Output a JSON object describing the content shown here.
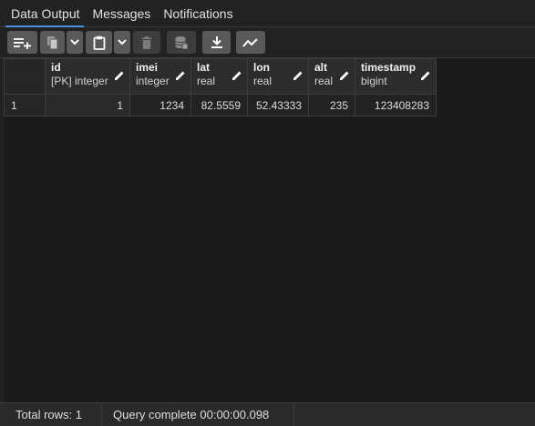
{
  "tabs": [
    {
      "label": "Data Output",
      "active": true
    },
    {
      "label": "Messages",
      "active": false
    },
    {
      "label": "Notifications",
      "active": false
    }
  ],
  "toolbar": {
    "buttons": [
      {
        "name": "add-row-button",
        "icon": "add-row-icon",
        "enabled": true
      },
      {
        "name": "copy-button",
        "icon": "copy-icon",
        "enabled": false
      },
      {
        "name": "copy-dropdown-button",
        "icon": "chevron-down-icon",
        "enabled": true
      },
      {
        "name": "paste-button",
        "icon": "clipboard-icon",
        "enabled": true
      },
      {
        "name": "paste-dropdown-button",
        "icon": "chevron-down-icon",
        "enabled": true
      },
      {
        "name": "delete-button",
        "icon": "trash-icon",
        "enabled": false
      },
      {
        "name": "save-data-button",
        "icon": "database-save-icon",
        "enabled": false
      },
      {
        "name": "download-button",
        "icon": "download-icon",
        "enabled": true
      },
      {
        "name": "graph-button",
        "icon": "line-chart-icon",
        "enabled": true
      }
    ]
  },
  "grid": {
    "columns": [
      {
        "name": "id",
        "type": "[PK] integer"
      },
      {
        "name": "imei",
        "type": "integer"
      },
      {
        "name": "lat",
        "type": "real"
      },
      {
        "name": "lon",
        "type": "real"
      },
      {
        "name": "alt",
        "type": "real"
      },
      {
        "name": "timestamp",
        "type": "bigint"
      }
    ],
    "rows": [
      {
        "row_number": "1",
        "cells": [
          "1",
          "1234",
          "82.5559",
          "52.43333",
          "235",
          "123408283"
        ]
      }
    ]
  },
  "status": {
    "total_rows": "Total rows: 1",
    "query_status": "Query complete 00:00:00.098"
  },
  "colors": {
    "background": "#222222",
    "toolbar_button": "#595959",
    "active_tab_underline": "#4a90d9"
  }
}
